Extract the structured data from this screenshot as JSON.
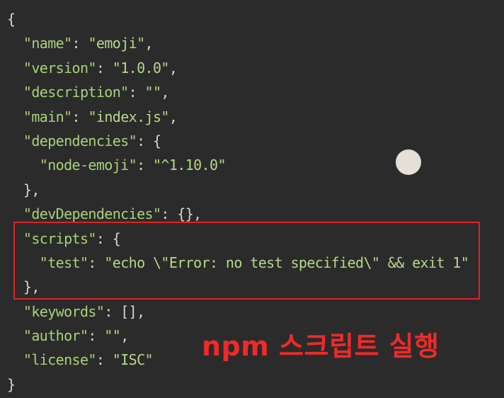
{
  "code": {
    "open_brace": "{",
    "close_brace": "}",
    "name_key": "\"name\"",
    "name_val": "\"emoji\"",
    "version_key": "\"version\"",
    "version_val": "\"1.0.0\"",
    "description_key": "\"description\"",
    "description_val": "\"\"",
    "main_key": "\"main\"",
    "main_val": "\"index.js\"",
    "dependencies_key": "\"dependencies\"",
    "node_emoji_key": "\"node-emoji\"",
    "node_emoji_val": "\"^1.10.0\"",
    "dev_dependencies_key": "\"devDependencies\"",
    "dev_dependencies_val": "{}",
    "scripts_key": "\"scripts\"",
    "test_key": "\"test\"",
    "test_val": "\"echo \\\"Error: no test specified\\\" && exit 1\"",
    "keywords_key": "\"keywords\"",
    "keywords_val": "[]",
    "author_key": "\"author\"",
    "author_val": "\"\"",
    "license_key": "\"license\"",
    "license_val": "\"ISC\""
  },
  "annotation": {
    "text": "npm 스크립트 실행",
    "color": "#ee2a2a"
  },
  "highlight": {
    "color": "#e0222a"
  }
}
